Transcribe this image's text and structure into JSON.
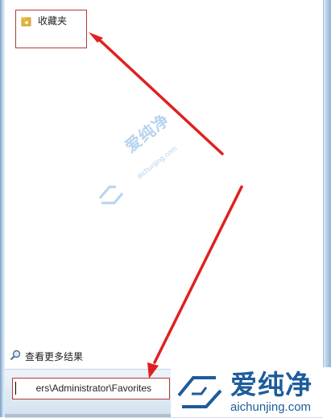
{
  "results": {
    "items": [
      {
        "label": "收藏夹",
        "icon": "folder-star-icon"
      }
    ],
    "see_more_label": "查看更多结果",
    "see_more_icon": "search-icon"
  },
  "search": {
    "value": "ers\\Administrator\\Favorites"
  },
  "watermark": {
    "center_cn": "爱纯净",
    "center_en": "aichunjing.com",
    "logo_cn": "爱纯净",
    "logo_en": "aichunjing.com",
    "color": "#1d5c9c"
  },
  "annotation": {
    "highlight_color": "#b73a3a",
    "arrow_color": "#e02020"
  }
}
